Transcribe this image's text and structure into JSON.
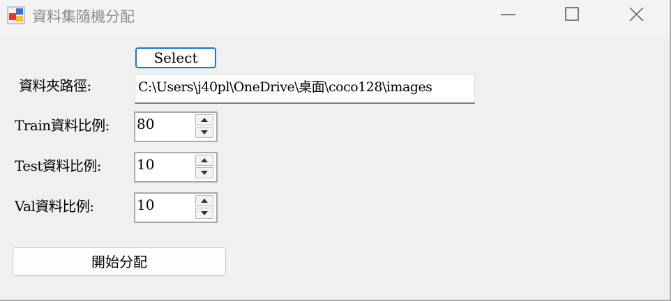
{
  "window": {
    "title": "資料集隨機分配"
  },
  "titlebar": {
    "icons": [
      "app-icon",
      "minimize-icon",
      "maximize-icon",
      "close-icon"
    ]
  },
  "form": {
    "select_button": "Select",
    "folder_label": "資料夾路徑:",
    "folder_path": "C:\\Users\\j40pl\\OneDrive\\桌面\\coco128\\images",
    "train_label": "Train資料比例:",
    "train_value": "80",
    "test_label": "Test資料比例:",
    "test_value": "10",
    "val_label": "Val資料比例:",
    "val_value": "10",
    "start_button": "開始分配"
  },
  "colors": {
    "focus_border": "#1a73d9",
    "window_bg": "#f0f0f0"
  }
}
